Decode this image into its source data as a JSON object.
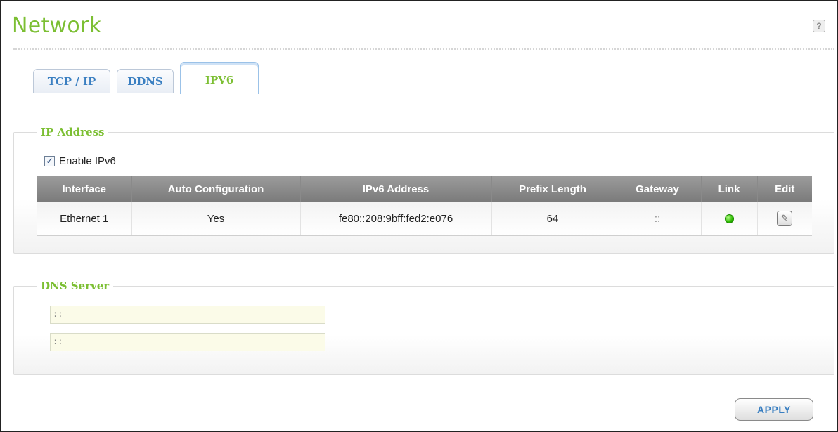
{
  "header": {
    "title": "Network",
    "help_icon": "question-icon"
  },
  "tabs": [
    {
      "label": "TCP / IP",
      "active": false
    },
    {
      "label": "DDNS",
      "active": false
    },
    {
      "label": "IPV6",
      "active": true
    }
  ],
  "ip_section": {
    "legend": "IP Address",
    "enable_label": "Enable IPv6",
    "enable_checked": true,
    "columns": [
      "Interface",
      "Auto Configuration",
      "IPv6 Address",
      "Prefix Length",
      "Gateway",
      "Link",
      "Edit"
    ],
    "rows": [
      {
        "interface": "Ethernet 1",
        "auto_config": "Yes",
        "address": "fe80::208:9bff:fed2:e076",
        "prefix": "64",
        "gateway": "::",
        "link_status": "up",
        "edit_icon": "pencil-icon"
      }
    ]
  },
  "dns_section": {
    "legend": "DNS Server",
    "primary_value": "::",
    "secondary_value": "::"
  },
  "footer": {
    "apply_label": "APPLY"
  },
  "colors": {
    "accent_green": "#7cbf33",
    "tab_blue": "#3a7fc1",
    "header_gray": "#8a8a8a",
    "link_up": "#2bb800",
    "input_bg": "#fbfbe8"
  }
}
